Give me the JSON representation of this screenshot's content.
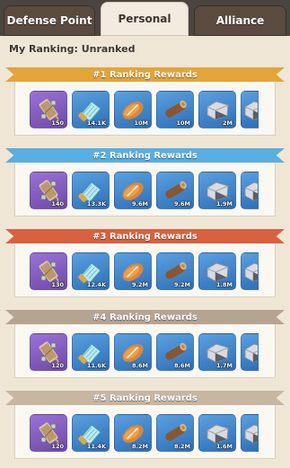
{
  "tabs": [
    {
      "label": "Defense Point"
    },
    {
      "label": "Personal"
    },
    {
      "label": "Alliance"
    }
  ],
  "my_ranking": "My Ranking: Unranked",
  "colors": {
    "ribbon_1": "#e3a43a",
    "ribbon_2": "#5aaee0",
    "ribbon_3": "#d9613f",
    "ribbon_4": "#b6a493",
    "ribbon_5": "#c7b6a2"
  },
  "sections": [
    {
      "title": "#1 Ranking Rewards",
      "items": [
        "150",
        "14.1K",
        "10M",
        "10M",
        "2M"
      ]
    },
    {
      "title": "#2 Ranking Rewards",
      "items": [
        "140",
        "13.3K",
        "9.6M",
        "9.6M",
        "1.9M"
      ]
    },
    {
      "title": "#3 Ranking Rewards",
      "items": [
        "130",
        "12.4K",
        "9.2M",
        "9.2M",
        "1.8M"
      ]
    },
    {
      "title": "#4 Ranking Rewards",
      "items": [
        "120",
        "11.6K",
        "8.6M",
        "8.6M",
        "1.7M"
      ]
    },
    {
      "title": "#5 Ranking Rewards",
      "items": [
        "120",
        "11.4K",
        "8.2M",
        "8.2M",
        "1.6M"
      ]
    }
  ],
  "item_icons": [
    "rope-spool-icon",
    "blueprint-scroll-icon",
    "bread-loaf-icon",
    "wood-log-icon",
    "stone-block-icon",
    "partial-item-icon"
  ]
}
